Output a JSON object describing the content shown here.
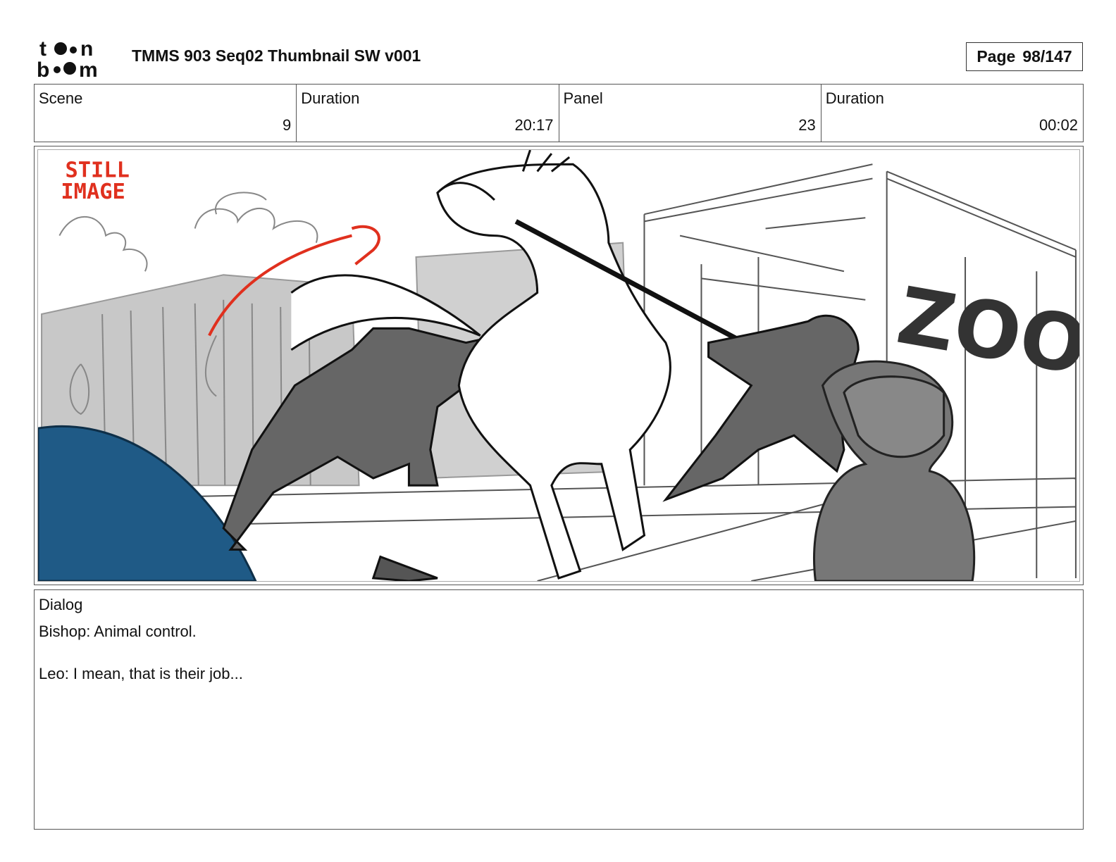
{
  "header": {
    "logo_text": "toon boom",
    "title": "TMMS 903 Seq02 Thumbnail SW v001",
    "page_label": "Page",
    "page_value": "98/147"
  },
  "info": {
    "scene_label": "Scene",
    "scene_value": "9",
    "scene_duration_label": "Duration",
    "scene_duration_value": "20:17",
    "panel_label": "Panel",
    "panel_value": "23",
    "panel_duration_label": "Duration",
    "panel_duration_value": "00:02"
  },
  "panel": {
    "still_image_line1": "STILL",
    "still_image_line2": "IMAGE",
    "zoo_sign": "ZOO",
    "colors": {
      "annotation_red": "#e0301e",
      "blue_shape": "#1f5a86",
      "figure_gray": "#666666",
      "building_gray": "#c8c8c8"
    }
  },
  "dialog": {
    "label": "Dialog",
    "text": "Bishop: Animal control.\n\nLeo: I mean, that is their job..."
  }
}
